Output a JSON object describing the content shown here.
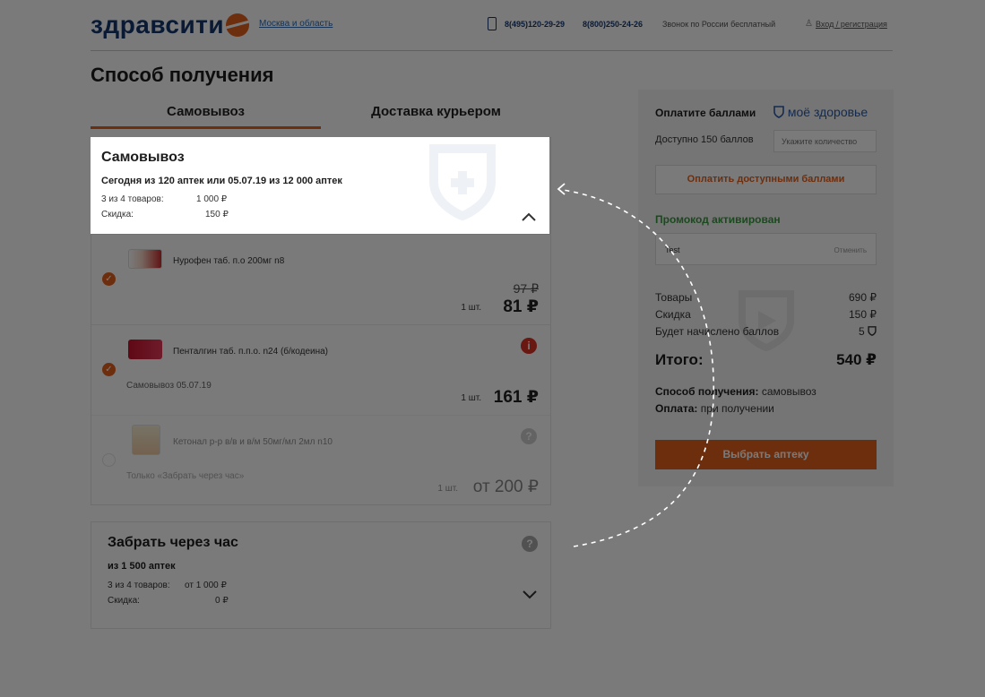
{
  "header": {
    "logo": "здравсити",
    "region": "Москва и область",
    "phone1": "8(495)120-29-29",
    "phone2": "8(800)250-24-26",
    "free_call": "Звонок по России бесплатный",
    "login": "Вход / регистрация"
  },
  "page": {
    "title": "Способ получения"
  },
  "tabs": [
    {
      "label": "Самовывоз",
      "active": true
    },
    {
      "label": "Доставка курьером",
      "active": false
    }
  ],
  "pickup": {
    "title": "Самовывоз",
    "subtitle": "Сегодня из 120 аптек или 05.07.19 из 12 000 аптек",
    "goods_label": "3 из 4 товаров:",
    "goods_value": "1 000 ₽",
    "discount_label": "Скидка:",
    "discount_value": "150 ₽"
  },
  "items": [
    {
      "name": "Нурофен таб. п.о 200мг n8",
      "old_price": "97 ₽",
      "qty": "1 шт.",
      "price": "81 ₽",
      "note": "",
      "checked": true
    },
    {
      "name": "Пенталгин таб. п.п.о. n24 (б/кодеина)",
      "old_price": "",
      "qty": "1 шт.",
      "price": "161 ₽",
      "note": "Самовывоз 05.07.19",
      "checked": true,
      "badge": "i"
    },
    {
      "name": "Кетонал р-р в/в и в/м 50мг/мл 2мл n10",
      "old_price": "",
      "qty": "1 шт.",
      "price": "от 200 ₽",
      "note": "Только «Забрать через час»",
      "checked": false,
      "badge": "?"
    }
  ],
  "hour": {
    "title": "Забрать через час",
    "subtitle": "из 1 500 аптек",
    "goods_label": "3 из 4 товаров:",
    "goods_value": "от 1 000 ₽",
    "discount_label": "Скидка:",
    "discount_value": "0 ₽",
    "badge": "?"
  },
  "sidebar": {
    "points_title": "Оплатите баллами",
    "brand": "моё здоровье",
    "available": "Доступно 150 баллов",
    "points_placeholder": "Укажите количество",
    "pay_button": "Оплатить доступными баллами",
    "promo_title": "Промокод активирован",
    "promo_code": "Test",
    "promo_cancel": "Отменить",
    "rows": [
      {
        "label": "Товары",
        "value": "690 ₽"
      },
      {
        "label": "Скидка",
        "value": "150 ₽"
      },
      {
        "label": "Будет начислено баллов",
        "value": "5"
      }
    ],
    "total_label": "Итого:",
    "total_value": "540 ₽",
    "method_label": "Способ получения:",
    "method_value": "самовывоз",
    "payment_label": "Оплата:",
    "payment_value": "при получении",
    "choose_button": "Выбрать аптеку"
  },
  "colors": {
    "accent": "#e4611d",
    "brand_blue": "#17386e",
    "promo_green": "#3a9a3f"
  }
}
